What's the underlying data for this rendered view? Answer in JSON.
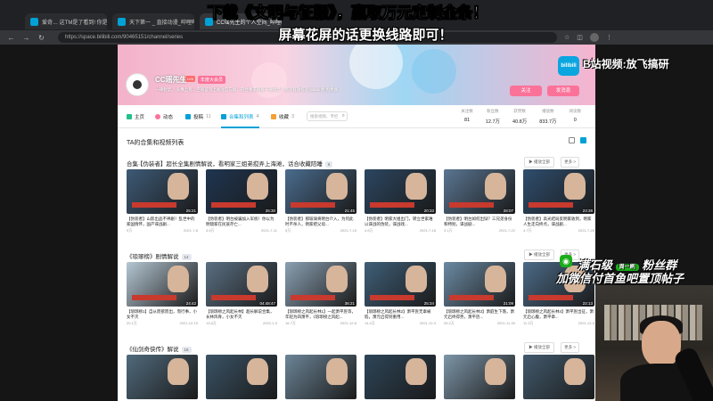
{
  "colors": {
    "accent": "#00a1d6",
    "pink": "#fb7299",
    "caption": "#c83a2e"
  },
  "browser": {
    "tabs": [
      {
        "title": "爱奇… 这TM是了看到!  你是精..."
      },
      {
        "title": "天下第一 _ 直接动漫_哔哩哔哩"
      },
      {
        "title": "CC瑶先生的个人空间_哔哩哔哩"
      }
    ],
    "url": "https://space.bilibili.com/90465151/channel/series"
  },
  "overlay": {
    "line1": "下载《文明与征服》，赢取万元定制金条！",
    "line2": "屏幕花屏的话更换线路即可！",
    "bili_text": "B站视频:放飞搞研",
    "promo_top_left": "满石级",
    "promo_top_mid": "周一刷",
    "promo_top_right": "粉丝群",
    "promo_bottom": "加微信付首鱼吧置顶帖子"
  },
  "profile": {
    "name": "CC瑶先生",
    "level": "LV6",
    "vip": "年度大会员",
    "sign": "一律封禁。 头像上有，空间首页上关注官方群，符合要求的将一律封禁，两次有效作品  bilibili 会  免费群",
    "follow_label": "关注",
    "message_label": "发消息",
    "logo": "bilibili"
  },
  "nav": {
    "items": [
      {
        "label": "主页",
        "count": ""
      },
      {
        "label": "动态",
        "count": ""
      },
      {
        "label": "投稿",
        "count": "11"
      },
      {
        "label": "合集和列表",
        "count": "4"
      },
      {
        "label": "收藏",
        "count": "3"
      }
    ],
    "search_placeholder": "搜索视频、专栏",
    "stats": [
      {
        "label": "关注数",
        "value": "81"
      },
      {
        "label": "粉丝数",
        "value": "12.7万"
      },
      {
        "label": "获赞数",
        "value": "40.8万"
      },
      {
        "label": "播放数",
        "value": "833.7万"
      },
      {
        "label": "阅读数",
        "value": "0"
      }
    ]
  },
  "content": {
    "title": "TA的合集和视频列表",
    "play_all": "▶ 播放全部",
    "more": "更多 >",
    "sections": [
      {
        "heading": "合集·【伪装者】超长全集剧情解说，看明家三姐弟搅弄上海滩，话合收藏陪睡",
        "count": "6",
        "cards": [
          {
            "duration": "25:21",
            "title": "【伪装者】山影出品不神剧！乱世中的家国情怀，国产谍战剧...",
            "views": "9万",
            "date": "2021-7-8"
          },
          {
            "duration": "25:30",
            "title": "【伪装者】明台被骗加入军统！你以为明镜家在民族存亡...",
            "views": "3.6万",
            "date": "2021-7-11"
          },
          {
            "duration": "21:45",
            "title": "【伪装者】那玻璃将明台介入，为何此时不杀人，明家把父母...",
            "views": "5万",
            "date": "2021-7-15"
          },
          {
            "duration": "20:33",
            "title": "【伪装者】明家大姐出门，转立世家难以谍战的伪装，谍战戏...",
            "views": "4.6万",
            "date": "2021-7-18"
          },
          {
            "duration": "28:07",
            "title": "【伪装者】明台如何出狱？三兄弟身份和特别，谍战剧...",
            "views": "3.1万",
            "date": "2021-7-22"
          },
          {
            "duration": "23:39",
            "title": "【伪装者】高光结局反明家收到，明家人生走向终点，谍战剧...",
            "views": "4.7万",
            "date": "2021-7-26"
          }
        ]
      },
      {
        "heading": "《琅琊榜》剧情解说",
        "count": "14",
        "cards": [
          {
            "duration": "24:42",
            "title": "【琅琊榜1】自从而欲而出，而行事，小女不灭",
            "views": "20.1万",
            "date": "2021-12-15"
          },
          {
            "duration": "04:48:47",
            "title": "【琅琊榜之风起长林】超长解说合集，长林风骨，小女不灭",
            "views": "13.8万",
            "date": "2022-1-3"
          },
          {
            "duration": "36:21",
            "title": "【琅琊榜之风起长林1】一起萧平旌等，年轻为四萧平，《琅琊榜之风起...",
            "views": "16.7万",
            "date": "2021-12-8"
          },
          {
            "duration": "25:34",
            "title": "【琅琊榜之风起长林2】萧平旌无辜被陷，萧元启得到重用...",
            "views": "14.4万",
            "date": "2021-12-3"
          },
          {
            "duration": "21:09",
            "title": "【琅琊榜之风起长林3】萧庭生下落，萧元启终得势，萧平旌...",
            "views": "26.2万",
            "date": "2021-11-30"
          },
          {
            "duration": "22:13",
            "title": "【琅琊榜之风起长林4】萧平旌出征，萧元启心腹，萧平章...",
            "views": "11.3万",
            "date": "2021-12-5"
          }
        ]
      },
      {
        "heading": "《仙剑奇侠传》解说",
        "count": "15",
        "cards": [
          {
            "duration": "",
            "title": "",
            "views": "",
            "date": ""
          },
          {
            "duration": "",
            "title": "",
            "views": "",
            "date": ""
          },
          {
            "duration": "",
            "title": "",
            "views": "",
            "date": ""
          },
          {
            "duration": "",
            "title": "",
            "views": "",
            "date": ""
          },
          {
            "duration": "",
            "title": "",
            "views": "",
            "date": ""
          },
          {
            "duration": "",
            "title": "",
            "views": "",
            "date": ""
          }
        ]
      }
    ]
  }
}
